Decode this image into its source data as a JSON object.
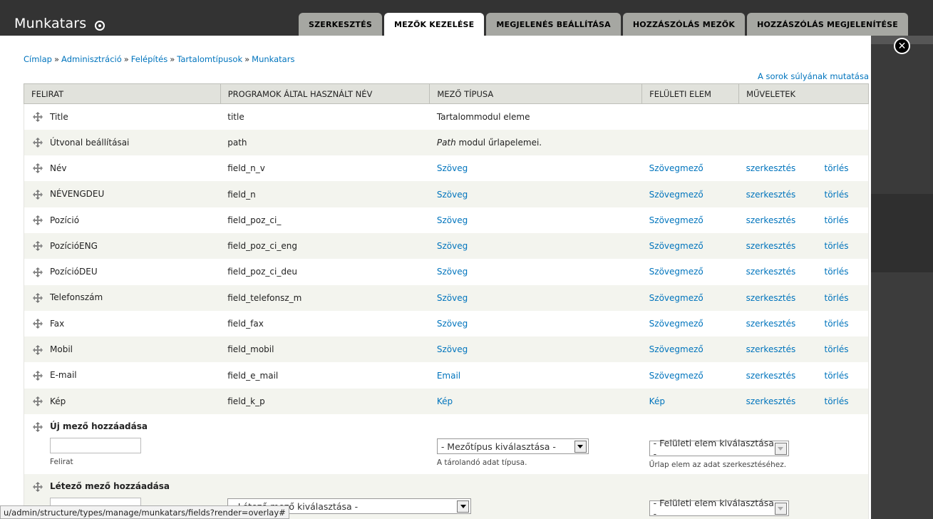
{
  "site": {
    "title": "Munkatars"
  },
  "tabs": [
    {
      "label": "SZERKESZTÉS",
      "active": false
    },
    {
      "label": "MEZŐK KEZELÉSE",
      "active": true
    },
    {
      "label": "MEGJELENÉS BEÁLLÍTÁSA",
      "active": false
    },
    {
      "label": "HOZZÁSZÓLÁS MEZŐK",
      "active": false
    },
    {
      "label": "HOZZÁSZÓLÁS MEGJELENÍTÉSE",
      "active": false
    }
  ],
  "breadcrumb": [
    "Címlap",
    "Adminisztráció",
    "Felépítés",
    "Tartalomtípusok",
    "Munkatars"
  ],
  "weights_link": "A sorok súlyának mutatása",
  "table": {
    "headers": [
      "FELIRAT",
      "PROGRAMOK ÁLTAL HASZNÁLT NÉV",
      "MEZŐ TÍPUSA",
      "FELÜLETI ELEM",
      "MŰVELETEK"
    ],
    "rows": [
      {
        "label": "Title",
        "machine": "title",
        "type": "Tartalommodul eleme",
        "widget": "",
        "edit": "",
        "delete": ""
      },
      {
        "label": "Útvonal beállításai",
        "machine": "path",
        "type_em": "Path",
        "type": " modul űrlapelemei.",
        "widget": "",
        "edit": "",
        "delete": ""
      },
      {
        "label": "Név",
        "machine": "field_n_v",
        "type": "Szöveg",
        "widget": "Szövegmező",
        "edit": "szerkesztés",
        "delete": "törlés"
      },
      {
        "label": "NÉVENGDEU",
        "machine": "field_n",
        "type": "Szöveg",
        "widget": "Szövegmező",
        "edit": "szerkesztés",
        "delete": "törlés"
      },
      {
        "label": "Pozíció",
        "machine": "field_poz_ci_",
        "type": "Szöveg",
        "widget": "Szövegmező",
        "edit": "szerkesztés",
        "delete": "törlés"
      },
      {
        "label": "PozícióENG",
        "machine": "field_poz_ci_eng",
        "type": "Szöveg",
        "widget": "Szövegmező",
        "edit": "szerkesztés",
        "delete": "törlés"
      },
      {
        "label": "PozícióDEU",
        "machine": "field_poz_ci_deu",
        "type": "Szöveg",
        "widget": "Szövegmező",
        "edit": "szerkesztés",
        "delete": "törlés"
      },
      {
        "label": "Telefonszám",
        "machine": "field_telefonsz_m",
        "type": "Szöveg",
        "widget": "Szövegmező",
        "edit": "szerkesztés",
        "delete": "törlés"
      },
      {
        "label": "Fax",
        "machine": "field_fax",
        "type": "Szöveg",
        "widget": "Szövegmező",
        "edit": "szerkesztés",
        "delete": "törlés"
      },
      {
        "label": "Mobil",
        "machine": "field_mobil",
        "type": "Szöveg",
        "widget": "Szövegmező",
        "edit": "szerkesztés",
        "delete": "törlés"
      },
      {
        "label": "E-mail",
        "machine": "field_e_mail",
        "type": "Email",
        "widget": "Szövegmező",
        "edit": "szerkesztés",
        "delete": "törlés"
      },
      {
        "label": "Kép",
        "machine": "field_k_p",
        "type": "Kép",
        "widget": "Kép",
        "edit": "szerkesztés",
        "delete": "törlés"
      }
    ]
  },
  "new_field": {
    "title": "Új mező hozzáadása",
    "label_help": "Felirat",
    "type_select": "- Mezőtípus kiválasztása -",
    "type_help": "A tárolandó adat típusa.",
    "widget_select": "- Felületi elem kiválasztása -",
    "widget_help": "Űrlap elem az adat szerkesztéséhez."
  },
  "existing_field": {
    "title": "Létező mező hozzáadása",
    "field_select": "- Létező mező kiválasztása -",
    "widget_select": "- Felületi elem kiválasztása -"
  },
  "status_url": "u/admin/structure/types/manage/munkatars/fields?render=overlay#"
}
